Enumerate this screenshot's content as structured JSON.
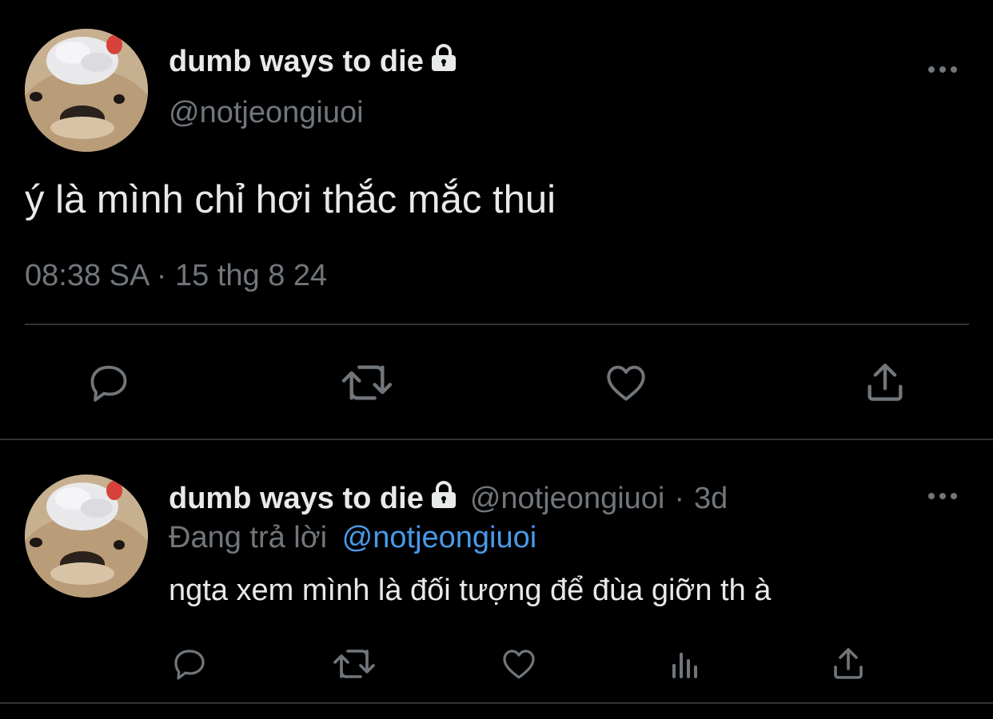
{
  "main_tweet": {
    "display_name": "dumb ways to die",
    "handle": "@notjeongiuoi",
    "text": "ý là mình chỉ hơi thắc mắc thui",
    "timestamp": "08:38 SA · 15 thg 8 24",
    "actions": [
      "reply-icon",
      "retweet-icon",
      "like-icon",
      "share-icon"
    ]
  },
  "reply_tweet": {
    "display_name": "dumb ways to die",
    "handle": "@notjeongiuoi",
    "separator": "·",
    "age": "3d",
    "replying_prefix": "Đang trả lời",
    "replying_to": "@notjeongiuoi",
    "text": "ngta xem mình là đối tượng để đùa giỡn th à",
    "actions": [
      "reply-icon",
      "retweet-icon",
      "like-icon",
      "views-icon",
      "share-icon"
    ]
  },
  "colors": {
    "background": "#000000",
    "text_primary": "#e7e9ea",
    "text_secondary": "#71767b",
    "link": "#4a99e9",
    "divider": "#2f3336"
  }
}
